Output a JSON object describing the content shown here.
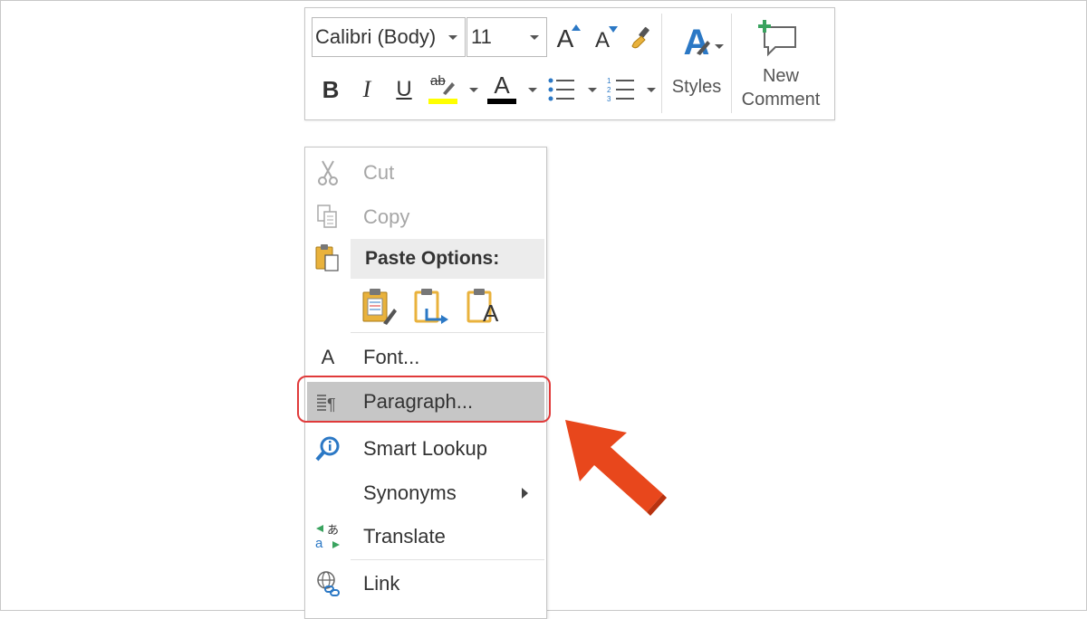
{
  "toolbar": {
    "font_name": "Calibri (Body)",
    "font_size": "11",
    "grow_font_glyph": "A",
    "shrink_font_glyph": "A",
    "bold_glyph": "B",
    "italic_glyph": "I",
    "underline_glyph": "U",
    "highlight_glyph": "ab",
    "font_color_glyph": "A",
    "styles_glyph": "A",
    "styles_label": "Styles",
    "new_comment_label_line1": "New",
    "new_comment_label_line2": "Comment",
    "highlight_color": "#ffff00",
    "font_color": "#000000",
    "accent_blue": "#2b78c5",
    "accent_green": "#3aa35f"
  },
  "menu": {
    "cut": "Cut",
    "copy": "Copy",
    "paste_options": "Paste Options:",
    "font_icon_glyph": "A",
    "font": "Font...",
    "paragraph": "Paragraph...",
    "smart_lookup": "Smart Lookup",
    "synonyms": "Synonyms",
    "translate": "Translate",
    "link": "Link",
    "paste_text_only_glyph": "A"
  },
  "annotation": {
    "highlight_color": "#e03a3a",
    "arrow_color": "#e8471c"
  }
}
